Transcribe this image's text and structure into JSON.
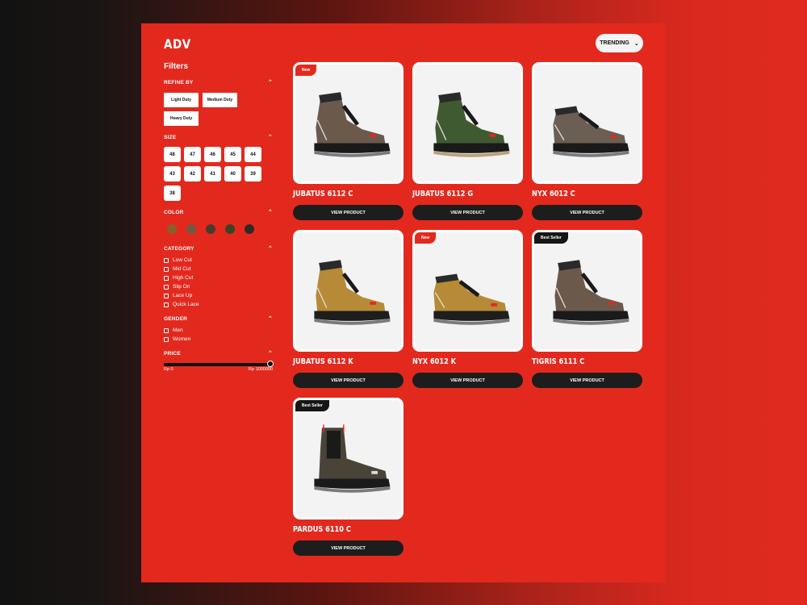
{
  "brand": {
    "logo": "ADV"
  },
  "sort": {
    "label": "TRENDING"
  },
  "filters": {
    "title": "Filters",
    "refine": {
      "label": "REFINE BY",
      "options": [
        "Light Duty",
        "Medium Duty",
        "Heavy Duty"
      ]
    },
    "size": {
      "label": "SIZE",
      "options": [
        "48",
        "47",
        "46",
        "45",
        "44",
        "43",
        "42",
        "41",
        "40",
        "39",
        "38"
      ]
    },
    "color": {
      "label": "COLOR",
      "swatches": [
        "#8a5f2a",
        "#6e5a44",
        "#4a3a2e",
        "#3a4424",
        "#2e2a24"
      ]
    },
    "category": {
      "label": "CATEGORY",
      "options": [
        "Low Cut",
        "Mid Cut",
        "High Cut",
        "Slip On",
        "Lace Up",
        "Quick Lace"
      ]
    },
    "gender": {
      "label": "GENDER",
      "options": [
        "Men",
        "Women"
      ]
    },
    "price": {
      "label": "PRICE",
      "min": "Rp 0",
      "max": "Rp 1000000"
    }
  },
  "products": [
    {
      "name": "JUBATUS 6112 C",
      "badge": "New",
      "badge_type": "new",
      "button": "VIEW PRODUCT",
      "upper": "#6b5a4c",
      "accent": "#4a3f36",
      "style": "high"
    },
    {
      "name": "JUBATUS 6112 G",
      "badge": "",
      "badge_type": "",
      "button": "VIEW PRODUCT",
      "upper": "#3f5a30",
      "accent": "#2e3a26",
      "style": "high"
    },
    {
      "name": "NYX 6012 C",
      "badge": "",
      "badge_type": "",
      "button": "VIEW PRODUCT",
      "upper": "#6b5e52",
      "accent": "#4e443b",
      "style": "low"
    },
    {
      "name": "JUBATUS 6112 K",
      "badge": "",
      "badge_type": "",
      "button": "VIEW PRODUCT",
      "upper": "#b68a36",
      "accent": "#7a5a22",
      "style": "high"
    },
    {
      "name": "NYX 6012 K",
      "badge": "New",
      "badge_type": "new",
      "button": "VIEW PRODUCT",
      "upper": "#b68a36",
      "accent": "#7a5a22",
      "style": "low"
    },
    {
      "name": "TIGRIS 6111 C",
      "badge": "Best Seller",
      "badge_type": "best",
      "button": "VIEW PRODUCT",
      "upper": "#6b5a4c",
      "accent": "#4a3f36",
      "style": "high"
    },
    {
      "name": "PARDUS 6110 C",
      "badge": "Best Seller",
      "badge_type": "best",
      "button": "VIEW PRODUCT",
      "upper": "#4a4438",
      "accent": "#2f2b24",
      "style": "chelsea"
    }
  ]
}
